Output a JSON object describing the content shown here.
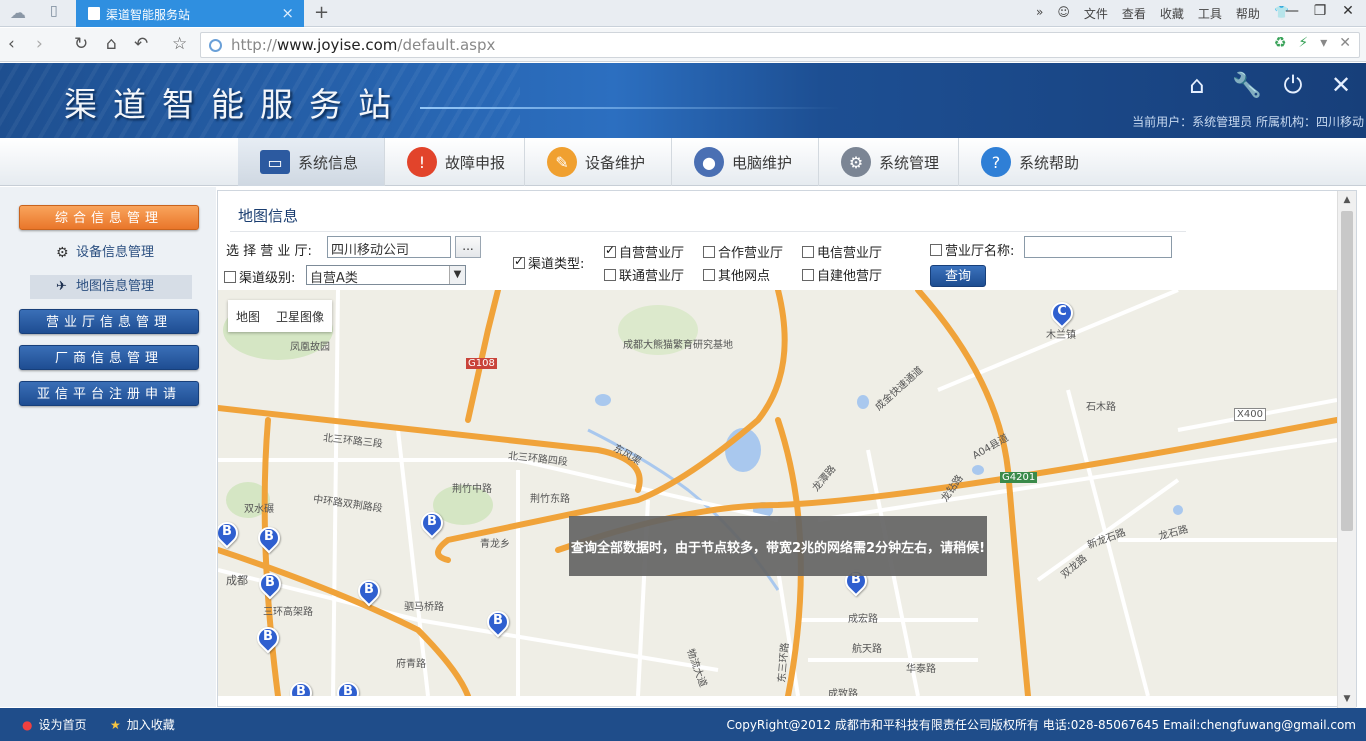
{
  "browser": {
    "tab_title": "渠道智能服务站",
    "new_tab": "+",
    "menu": [
      "»",
      "文件",
      "查看",
      "收藏",
      "工具",
      "帮助"
    ],
    "url_prefix": "http://",
    "url_host": "www.joyise.com",
    "url_path": "/default.aspx"
  },
  "header": {
    "site_title": "渠道智能服务站",
    "user_info": "当前用户：系统管理员 所属机构：四川移动",
    "icons": [
      "home-icon",
      "wrench-icon",
      "power-icon",
      "close-icon"
    ]
  },
  "nav": [
    {
      "label": "系统信息",
      "icon": "monitor-icon",
      "active": true
    },
    {
      "label": "故障申报",
      "icon": "warning-icon"
    },
    {
      "label": "设备维护",
      "icon": "wrench-icon"
    },
    {
      "label": "电脑维护",
      "icon": "user-icon"
    },
    {
      "label": "系统管理",
      "icon": "gear-icon"
    },
    {
      "label": "系统帮助",
      "icon": "help-icon"
    }
  ],
  "sidebar": {
    "group1": "综合信息管理",
    "sub1": "设备信息管理",
    "sub2": "地图信息管理",
    "group2": "营业厅信息管理",
    "group3": "厂商信息管理",
    "group4": "亚信平台注册申请"
  },
  "content": {
    "title": "地图信息",
    "select_shop_label": "选 择 营 业 厅:",
    "shop_value": "四川移动公司",
    "browse": "...",
    "level_label": "渠道级别:",
    "level_value": "自营A类",
    "type_label": "渠道类型:",
    "types": [
      "自营营业厅",
      "合作营业厅",
      "电信营业厅",
      "联通营业厅",
      "其他网点",
      "自建他营厅"
    ],
    "name_label": "营业厅名称:",
    "query": "查询"
  },
  "map": {
    "tab_map": "地图",
    "tab_satellite": "卫星图像",
    "notice": "查询全部数据时，由于节点较多，带宽2兆的网络需2分钟左右，请稍候!",
    "places": [
      "成都大熊猫繁育研究基地",
      "凤凰故园",
      "北三环路三段",
      "北三环路四段",
      "东风渠",
      "荆竹中路",
      "荆竹东路",
      "龙潭路",
      "中环路双荆路段",
      "双水碾",
      "成都",
      "三环高架路",
      "青龙乡",
      "驷马桥路",
      "府青路",
      "成宏路",
      "航天路",
      "华泰路",
      "成致路",
      "石木路",
      "新龙石路",
      "双龙路",
      "龙石路",
      "A04县道",
      "龙钻路",
      "木兰镇",
      "华泰路",
      "物流大道",
      "东三环路",
      "成金快速通道"
    ],
    "road_labels": [
      "G108",
      "G4201",
      "X400"
    ],
    "markers": [
      "B",
      "B",
      "B",
      "B",
      "B",
      "B",
      "B",
      "B",
      "B",
      "B",
      "C"
    ]
  },
  "footer": {
    "set_home": "设为首页",
    "add_fav": "加入收藏",
    "copyright": "CopyRight@2012 成都市和平科技有限责任公司版权所有 电话:028-85067645 Email:chengfuwang@gmail.com"
  }
}
